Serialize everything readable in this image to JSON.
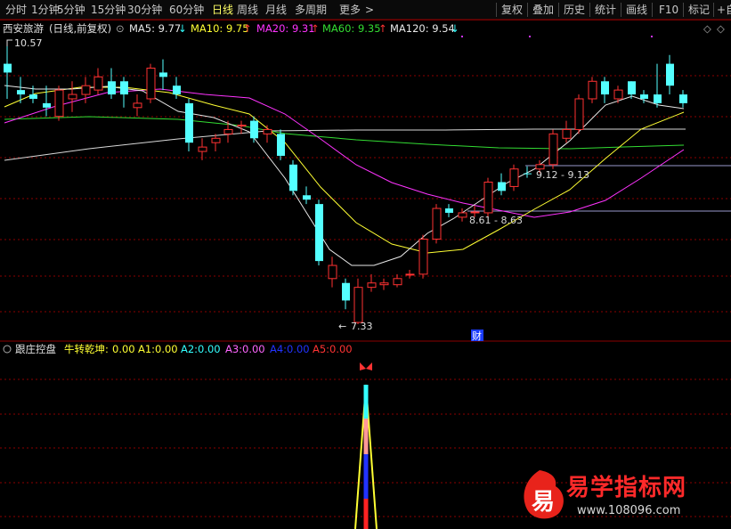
{
  "toolbar": {
    "left": [
      "分时",
      "1分钟",
      "5分钟",
      "15分钟",
      "30分钟",
      "60分钟",
      "日线",
      "周线",
      "月线",
      "多周期",
      "更多"
    ],
    "active_index": 6,
    "more_arrow": ">",
    "right": [
      "复权",
      "叠加",
      "历史",
      "统计",
      "画线",
      "F10",
      "标记",
      "+自"
    ]
  },
  "main_panel": {
    "stock": "西安旅游",
    "mode": "(日线,前复权)",
    "ma": [
      {
        "label": "MA5: 9.77",
        "arrow": "↓",
        "color": "#e8e8e8"
      },
      {
        "label": "MA10: 9.75",
        "arrow": "↑",
        "color": "#ffff33"
      },
      {
        "label": "MA20: 9.31",
        "arrow": "↑",
        "color": "#ff33ff"
      },
      {
        "label": "MA60: 9.35",
        "arrow": "↑",
        "color": "#33dd33"
      },
      {
        "label": "MA120: 9.54",
        "arrow": "↓",
        "color": "#e8e8e8"
      }
    ],
    "high_label": "10.57",
    "low_label": "7.33",
    "annot1": "9.12 - 9.13",
    "annot2": "8.61 - 8.63",
    "cai_label": "财"
  },
  "sub_panel": {
    "name": "跟庄控盘",
    "items": [
      {
        "label": "牛转乾坤:",
        "value": "0.00",
        "color": "#ffff33"
      },
      {
        "label": "A1:",
        "value": "0.00",
        "color": "#ffff33"
      },
      {
        "label": "A2:",
        "value": "0.00",
        "color": "#33ffff"
      },
      {
        "label": "A3:",
        "value": "0.00",
        "color": "#ff66ff"
      },
      {
        "label": "A4:",
        "value": "0.00",
        "color": "#2233ff"
      },
      {
        "label": "A5:",
        "value": "0.00",
        "color": "#ff3333"
      }
    ]
  },
  "watermark": {
    "brand": "易学指标网",
    "char": "易",
    "url": "www.108096.com"
  },
  "colors": {
    "up": "#ff3232",
    "down": "#54ffff",
    "axis": "#8b0000"
  },
  "chart_data": {
    "type": "candlestick",
    "candles": [
      [
        10.2,
        10.57,
        9.9,
        10.3,
        "down"
      ],
      [
        9.95,
        10.15,
        9.85,
        10.0,
        "down"
      ],
      [
        9.95,
        10.05,
        9.85,
        9.9,
        "down"
      ],
      [
        9.8,
        10.05,
        9.7,
        9.85,
        "down"
      ],
      [
        9.7,
        10.05,
        9.65,
        10.0,
        "up"
      ],
      [
        9.9,
        10.1,
        9.75,
        9.95,
        "up"
      ],
      [
        9.95,
        10.15,
        9.85,
        10.05,
        "up"
      ],
      [
        10.0,
        10.25,
        9.95,
        10.15,
        "up"
      ],
      [
        10.1,
        10.25,
        9.9,
        9.95,
        "down"
      ],
      [
        9.95,
        10.15,
        9.8,
        10.1,
        "down"
      ],
      [
        9.8,
        9.95,
        9.7,
        9.85,
        "up"
      ],
      [
        9.9,
        10.3,
        9.85,
        10.25,
        "up"
      ],
      [
        10.2,
        10.35,
        10.0,
        10.15,
        "down"
      ],
      [
        10.05,
        10.15,
        9.9,
        9.95,
        "down"
      ],
      [
        9.85,
        9.9,
        9.3,
        9.4,
        "down"
      ],
      [
        9.3,
        9.45,
        9.2,
        9.35,
        "up"
      ],
      [
        9.4,
        9.5,
        9.3,
        9.45,
        "up"
      ],
      [
        9.55,
        9.65,
        9.4,
        9.5,
        "up"
      ],
      [
        9.6,
        9.65,
        9.5,
        9.6,
        "up"
      ],
      [
        9.65,
        9.7,
        9.4,
        9.45,
        "down"
      ],
      [
        9.5,
        9.6,
        9.4,
        9.55,
        "up"
      ],
      [
        9.5,
        9.55,
        9.2,
        9.25,
        "down"
      ],
      [
        9.15,
        9.2,
        8.8,
        8.85,
        "down"
      ],
      [
        8.8,
        8.9,
        8.7,
        8.75,
        "down"
      ],
      [
        8.7,
        8.75,
        8.0,
        8.05,
        "down"
      ],
      [
        8.0,
        8.1,
        7.75,
        7.85,
        "up"
      ],
      [
        7.8,
        7.85,
        7.5,
        7.6,
        "down"
      ],
      [
        7.35,
        7.85,
        7.33,
        7.75,
        "up"
      ],
      [
        7.75,
        7.9,
        7.7,
        7.8,
        "up"
      ],
      [
        7.78,
        7.85,
        7.72,
        7.8,
        "up"
      ],
      [
        7.78,
        7.9,
        7.75,
        7.85,
        "up"
      ],
      [
        7.9,
        7.95,
        7.85,
        7.9,
        "up"
      ],
      [
        7.9,
        8.35,
        7.85,
        8.3,
        "up"
      ],
      [
        8.3,
        8.7,
        8.25,
        8.65,
        "up"
      ],
      [
        8.6,
        8.7,
        8.55,
        8.65,
        "down"
      ],
      [
        8.55,
        8.65,
        8.5,
        8.6,
        "up"
      ],
      [
        8.6,
        8.68,
        8.55,
        8.61,
        "up"
      ],
      [
        8.6,
        9.0,
        8.55,
        8.95,
        "up"
      ],
      [
        8.95,
        9.05,
        8.8,
        8.85,
        "down"
      ],
      [
        8.9,
        9.15,
        8.85,
        9.1,
        "up"
      ],
      [
        9.05,
        9.13,
        9.0,
        9.05,
        "down"
      ],
      [
        9.1,
        9.2,
        9.05,
        9.15,
        "up"
      ],
      [
        9.15,
        9.55,
        9.1,
        9.5,
        "up"
      ],
      [
        9.45,
        9.65,
        9.4,
        9.55,
        "up"
      ],
      [
        9.55,
        9.95,
        9.5,
        9.9,
        "up"
      ],
      [
        9.9,
        10.15,
        9.85,
        10.1,
        "up"
      ],
      [
        10.1,
        10.15,
        9.85,
        9.95,
        "down"
      ],
      [
        9.9,
        10.05,
        9.85,
        10.0,
        "up"
      ],
      [
        10.1,
        10.1,
        9.9,
        9.95,
        "down"
      ],
      [
        9.9,
        10.0,
        9.85,
        9.95,
        "down"
      ],
      [
        9.85,
        10.3,
        9.8,
        9.95,
        "down"
      ],
      [
        10.3,
        10.4,
        9.95,
        10.05,
        "down"
      ],
      [
        9.95,
        10.0,
        9.8,
        9.85,
        "down"
      ]
    ],
    "ymin": 7.33,
    "ymax": 10.57
  }
}
